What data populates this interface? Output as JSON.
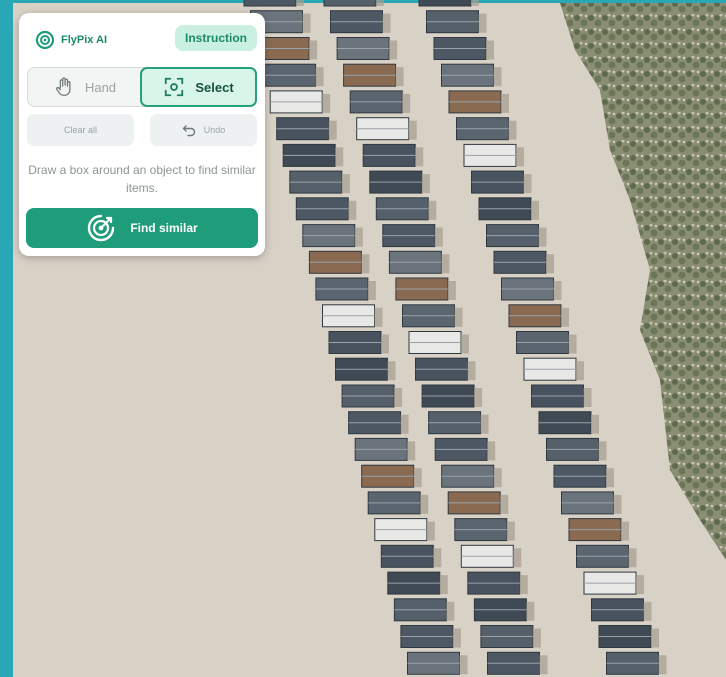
{
  "app": {
    "brand": "FlyPix AI",
    "instruction_label": "Instruction"
  },
  "toolbar": {
    "modes": [
      {
        "label": "Hand",
        "icon": "hand-icon",
        "active": false
      },
      {
        "label": "Select",
        "icon": "select-box-icon",
        "active": true
      }
    ],
    "clear_label": "Clear all",
    "undo_label": "Undo",
    "hint": "Draw a box around an object to find similar items.",
    "find_label": "Find similar"
  },
  "colors": {
    "accent": "#1f9c7a",
    "accent_light": "#c9f0e0",
    "sea": "#2aa7b5",
    "sand": "#d9d2c8",
    "dunes": "#6f7a5c"
  }
}
